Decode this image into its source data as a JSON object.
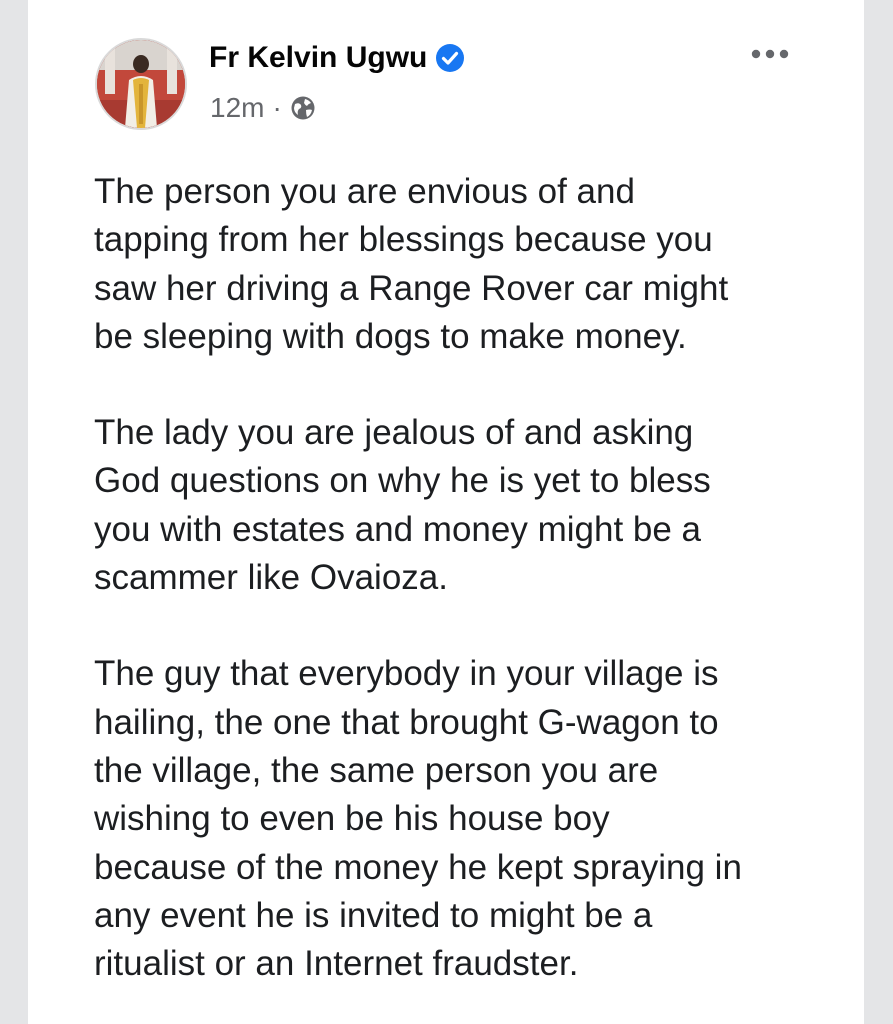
{
  "post": {
    "author": "Fr Kelvin Ugwu",
    "verified": true,
    "timestamp": "12m",
    "separator": "·",
    "audience_icon": "globe-icon",
    "more_icon": "more-options-icon",
    "paragraphs": [
      "The person you are envious of and\ntapping from her blessings because you\nsaw her driving a Range Rover car might\nbe sleeping with dogs to make money.",
      "The lady you are jealous of and asking\nGod questions on why he is yet to bless\nyou with estates and money might be a\nscammer like Ovaioza.",
      "The guy that everybody in your village is\nhailing, the one that brought G-wagon to\nthe village, the same person you are\nwishing to even be his house boy\nbecause of the money he kept spraying in\nany event he is invited to might be a\nritualist or an Internet fraudster."
    ]
  },
  "colors": {
    "verified_badge": "#1877f2",
    "text_primary": "#050505",
    "text_secondary": "#65676b",
    "background": "#ffffff",
    "page_background": "#e4e5e7"
  }
}
